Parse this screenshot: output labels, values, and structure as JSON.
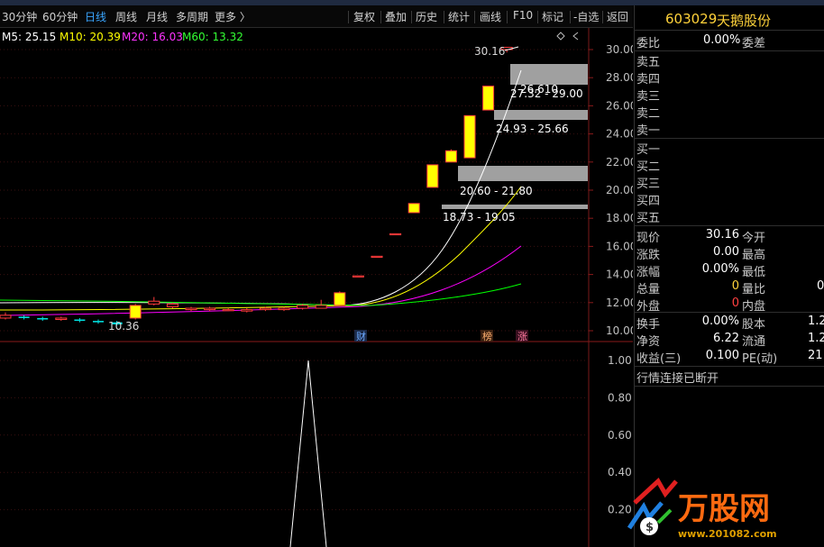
{
  "toolbar": {
    "periods": [
      "30分钟",
      "60分钟",
      "日线",
      "周线",
      "月线",
      "多周期",
      "更多 〉"
    ],
    "tools": [
      "复权",
      "叠加",
      "历史",
      "统计",
      "画线",
      "F10",
      "标记",
      "-自选",
      "返回"
    ]
  },
  "ma_legend": {
    "m5": "M5: 25.15",
    "m10": "M10: 20.39",
    "m20": "M20: 16.03",
    "m60": "M60: 13.32"
  },
  "colors": {
    "m5": "#ffffff",
    "m10": "#ffff00",
    "m20": "#ff00ff",
    "m60": "#00ff00",
    "up": "#ff3b3b",
    "upfill": "#ffff00",
    "down": "#00e0e0"
  },
  "price_axis": [
    "30.00",
    "28.00",
    "26.00",
    "24.00",
    "22.00",
    "20.00",
    "18.00",
    "16.00",
    "14.00",
    "12.00",
    "10.00"
  ],
  "volume_axis": [
    "1.00",
    "0.80",
    "0.60",
    "0.40",
    "0.20"
  ],
  "annotations": {
    "high": "30.16",
    "low": "10.36",
    "gap1": "27.32 - 29.00",
    "gap1_price": "26.610",
    "gap2": "24.93 - 25.66",
    "gap3": "20.60 - 21.80",
    "gap4": "18.73 - 19.05",
    "marker_cai": "财",
    "marker_bang": "榜",
    "marker_zhang": "涨"
  },
  "stock": {
    "code": "603029",
    "name": "天鹅股份"
  },
  "orderbook": {
    "weibi_label": "委比",
    "weibi_value": "0.00%",
    "weicha_label": "委差",
    "sell": [
      "卖五",
      "卖四",
      "卖三",
      "卖二",
      "卖一"
    ],
    "buy": [
      "买一",
      "买二",
      "买三",
      "买四",
      "买五"
    ]
  },
  "quote": [
    {
      "l1": "现价",
      "v1": "30.16",
      "l2": "今开"
    },
    {
      "l1": "涨跌",
      "v1": "0.00",
      "l2": "最高"
    },
    {
      "l1": "涨幅",
      "v1": "0.00%",
      "l2": "最低"
    },
    {
      "l1": "总量",
      "v1": "0",
      "l2": "量比",
      "v2": "0"
    },
    {
      "l1": "外盘",
      "v1": "0",
      "l2": "内盘"
    }
  ],
  "stats": [
    {
      "l1": "换手",
      "v1": "0.00%",
      "l2": "股本",
      "v2": "1.2"
    },
    {
      "l1": "净资",
      "v1": "6.22",
      "l2": "流通",
      "v2": "1.2"
    },
    {
      "l1": "收益(三)",
      "v1": "0.100",
      "l2": "PE(动)",
      "v2": "21"
    }
  ],
  "status_text": "行情连接已断开",
  "watermark": {
    "brand": "万股网",
    "url": "www.201082.com"
  },
  "chart_data": {
    "type": "candlestick",
    "ylim": [
      9.6,
      31.0
    ],
    "candles": [
      {
        "o": 10.9,
        "c": 11.1,
        "h": 11.3,
        "l": 10.8
      },
      {
        "o": 11.0,
        "c": 10.9,
        "h": 11.1,
        "l": 10.8
      },
      {
        "o": 10.9,
        "c": 10.8,
        "h": 11.0,
        "l": 10.7
      },
      {
        "o": 10.8,
        "c": 10.9,
        "h": 11.0,
        "l": 10.7
      },
      {
        "o": 10.8,
        "c": 10.7,
        "h": 10.9,
        "l": 10.6
      },
      {
        "o": 10.7,
        "c": 10.6,
        "h": 10.8,
        "l": 10.5
      },
      {
        "o": 10.6,
        "c": 10.45,
        "h": 10.7,
        "l": 10.36
      },
      {
        "o": 10.9,
        "c": 11.8,
        "h": 11.9,
        "l": 10.8
      },
      {
        "o": 11.9,
        "c": 12.1,
        "h": 12.4,
        "l": 11.8
      },
      {
        "o": 11.7,
        "c": 11.9,
        "h": 12.0,
        "l": 11.6
      },
      {
        "o": 11.5,
        "c": 11.6,
        "h": 11.7,
        "l": 11.4
      },
      {
        "o": 11.5,
        "c": 11.6,
        "h": 11.7,
        "l": 11.4
      },
      {
        "o": 11.5,
        "c": 11.5,
        "h": 11.6,
        "l": 11.4
      },
      {
        "o": 11.4,
        "c": 11.5,
        "h": 11.6,
        "l": 11.3
      },
      {
        "o": 11.5,
        "c": 11.6,
        "h": 11.7,
        "l": 11.4
      },
      {
        "o": 11.5,
        "c": 11.6,
        "h": 11.7,
        "l": 11.4
      },
      {
        "o": 11.6,
        "c": 11.8,
        "h": 11.9,
        "l": 11.5
      },
      {
        "o": 11.6,
        "c": 11.8,
        "h": 12.2,
        "l": 11.6
      },
      {
        "o": 11.8,
        "c": 12.7,
        "h": 12.8,
        "l": 11.8
      },
      {
        "o": 13.9,
        "c": 13.9,
        "h": 13.9,
        "l": 13.9
      },
      {
        "o": 15.3,
        "c": 15.3,
        "h": 15.3,
        "l": 15.3
      },
      {
        "o": 16.9,
        "c": 16.9,
        "h": 16.9,
        "l": 16.9
      },
      {
        "o": 18.4,
        "c": 19.05,
        "h": 19.05,
        "l": 18.4
      },
      {
        "o": 20.2,
        "c": 21.8,
        "h": 21.8,
        "l": 20.2
      },
      {
        "o": 22.0,
        "c": 22.8,
        "h": 22.9,
        "l": 22.0
      },
      {
        "o": 22.3,
        "c": 25.3,
        "h": 25.3,
        "l": 22.3
      },
      {
        "o": 25.7,
        "c": 27.4,
        "h": 27.4,
        "l": 25.7
      },
      {
        "o": 30.0,
        "c": 30.16,
        "h": 30.16,
        "l": 29.8
      }
    ],
    "volume": [
      0,
      0,
      0,
      0,
      0,
      0,
      0,
      0,
      0,
      0,
      0,
      0,
      0,
      0,
      0,
      0,
      0,
      0,
      0,
      0,
      0,
      0,
      0,
      0,
      0,
      0,
      0,
      0
    ]
  }
}
